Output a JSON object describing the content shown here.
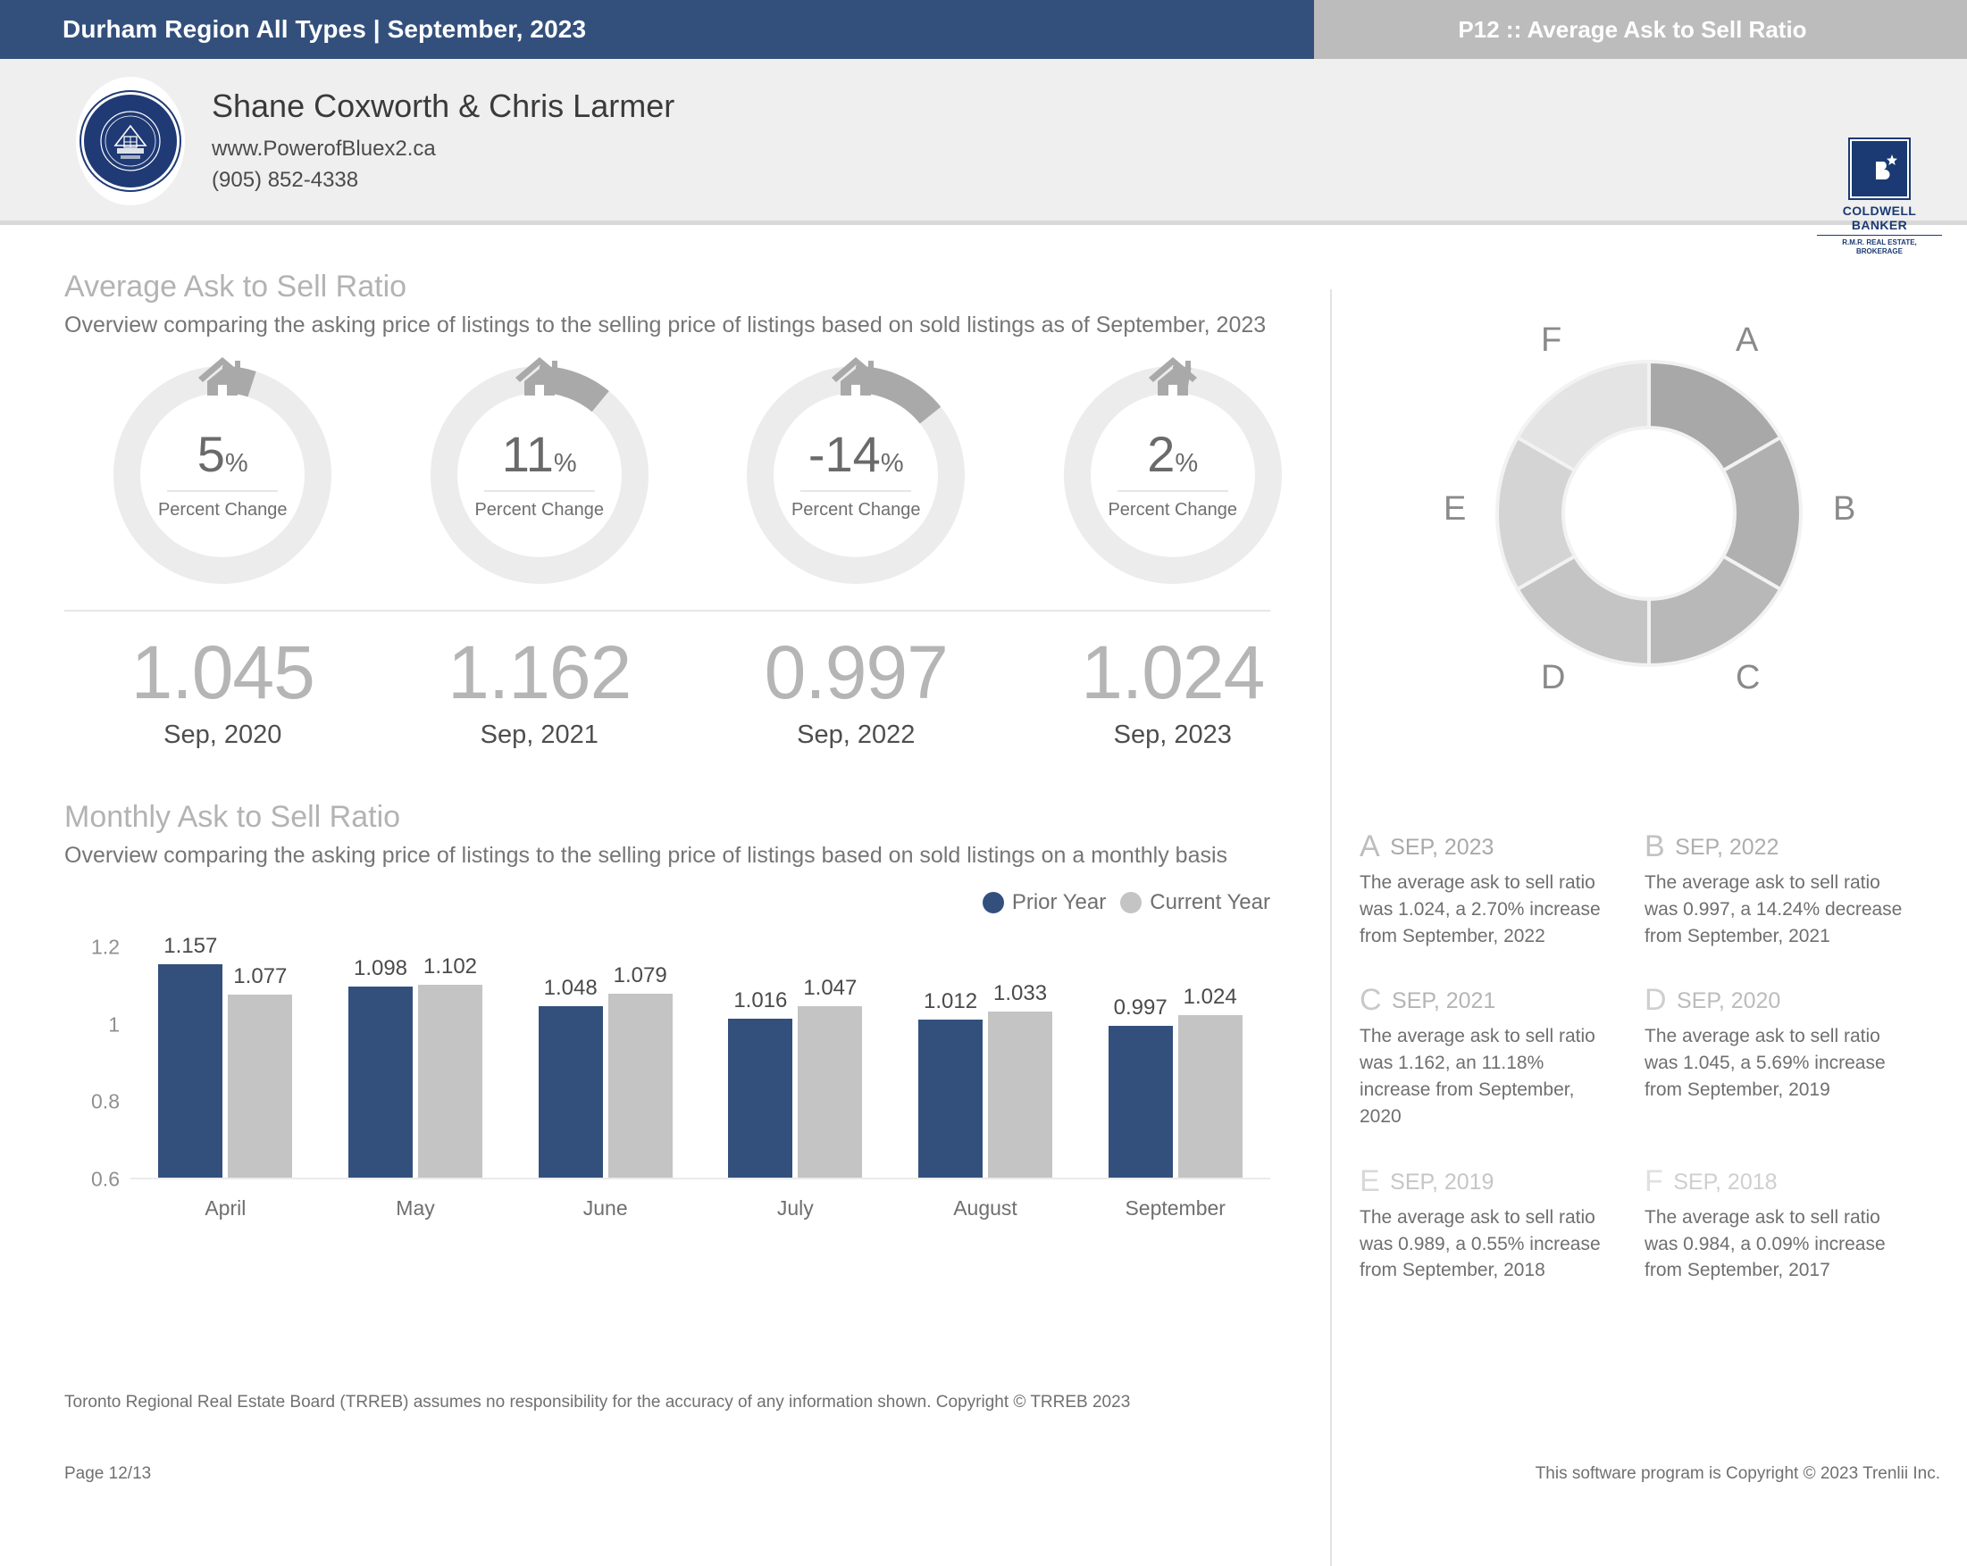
{
  "header": {
    "left_title": "Durham Region All Types | September, 2023",
    "right_title": "P12 :: Average Ask to Sell Ratio",
    "navy": "#33507d",
    "gray": "#bcbcbc"
  },
  "agent": {
    "name": "Shane Coxworth & Chris Larmer",
    "website": "www.PowerofBluex2.ca",
    "phone": "(905) 852-4338",
    "logo_icon": "powerofbluex2-seal-icon",
    "brokerage": {
      "mark": "CB",
      "name_line1": "COLDWELL",
      "name_line2": "BANKER",
      "sub_line1": "R.M.R. REAL ESTATE,",
      "sub_line2": "BROKERAGE"
    }
  },
  "overview": {
    "title": "Average Ask to Sell Ratio",
    "description": "Overview comparing the asking price of listings to the selling price of listings based on sold listings as of September, 2023",
    "gauges": [
      {
        "percent": "5",
        "symbol": "%",
        "label": "Percent Change",
        "fraction": 0.05,
        "icon": "house-icon"
      },
      {
        "percent": "11",
        "symbol": "%",
        "label": "Percent Change",
        "fraction": 0.11,
        "icon": "house-icon"
      },
      {
        "percent": "-14",
        "symbol": "%",
        "label": "Percent Change",
        "fraction": 0.1424,
        "icon": "house-icon"
      },
      {
        "percent": "2",
        "symbol": "%",
        "label": "Percent Change",
        "fraction": 0.027,
        "icon": "house-icon"
      }
    ],
    "totals": [
      {
        "value": "1.045",
        "label": "Sep, 2020"
      },
      {
        "value": "1.162",
        "label": "Sep, 2021"
      },
      {
        "value": "0.997",
        "label": "Sep, 2022"
      },
      {
        "value": "1.024",
        "label": "Sep, 2023"
      }
    ]
  },
  "monthly": {
    "title": "Monthly Ask to Sell Ratio",
    "description": "Overview comparing the asking price of listings to the selling price of listings based on sold listings on a monthly basis",
    "legend": [
      {
        "label": "Prior Year",
        "color": "#33507d"
      },
      {
        "label": "Current Year",
        "color": "#c4c4c4"
      }
    ]
  },
  "chart_data": {
    "type": "bar",
    "title": "Monthly Ask to Sell Ratio",
    "xlabel": "",
    "ylabel": "",
    "ylim": [
      0.6,
      1.2
    ],
    "yticks": [
      "0.6",
      "0.8",
      "1",
      "1.2"
    ],
    "grid": false,
    "legend_position": "top-right",
    "categories": [
      "April",
      "May",
      "June",
      "July",
      "August",
      "September"
    ],
    "series": [
      {
        "name": "Prior Year",
        "color": "#33507d",
        "values": [
          1.157,
          1.098,
          1.048,
          1.016,
          1.012,
          0.997
        ]
      },
      {
        "name": "Current Year",
        "color": "#c4c4c4",
        "values": [
          1.077,
          1.102,
          1.079,
          1.047,
          1.033,
          1.024
        ]
      }
    ],
    "value_labels": [
      [
        "1.157",
        "1.077"
      ],
      [
        "1.098",
        "1.102"
      ],
      [
        "1.048",
        "1.079"
      ],
      [
        "1.016",
        "1.047"
      ],
      [
        "1.012",
        "1.033"
      ],
      [
        "0.997",
        "1.024"
      ]
    ]
  },
  "donut": {
    "type": "donut",
    "segments": [
      {
        "letter": "A",
        "color": "#a8a8a8",
        "share": 16.667
      },
      {
        "letter": "B",
        "color": "#b0b0b0",
        "share": 16.667
      },
      {
        "letter": "C",
        "color": "#b8b8b8",
        "share": 16.667
      },
      {
        "letter": "D",
        "color": "#c4c4c4",
        "share": 16.667
      },
      {
        "letter": "E",
        "color": "#d4d4d4",
        "share": 16.667
      },
      {
        "letter": "F",
        "color": "#e4e4e4",
        "share": 16.667
      }
    ]
  },
  "cards": [
    {
      "letter": "A",
      "period": "SEP, 2023",
      "text": "The average ask to sell ratio was 1.024, a 2.70% increase from September, 2022",
      "letter_color": "#bdbdbd",
      "period_color": "#a9a9a9"
    },
    {
      "letter": "B",
      "period": "SEP, 2022",
      "text": "The average ask to sell ratio was 0.997, a 14.24% decrease from September, 2021",
      "letter_color": "#c2c2c2",
      "period_color": "#aeaeae"
    },
    {
      "letter": "C",
      "period": "SEP, 2021",
      "text": "The average ask to sell ratio was 1.162, an 11.18% increase from September, 2020",
      "letter_color": "#c9c9c9",
      "period_color": "#b5b5b5"
    },
    {
      "letter": "D",
      "period": "SEP, 2020",
      "text": "The average ask to sell ratio was 1.045, a 5.69% increase from September, 2019",
      "letter_color": "#cfcfcf",
      "period_color": "#bcbcbc"
    },
    {
      "letter": "E",
      "period": "SEP, 2019",
      "text": "The average ask to sell ratio was 0.989, a 0.55% increase from September, 2018",
      "letter_color": "#d8d8d8",
      "period_color": "#c6c6c6"
    },
    {
      "letter": "F",
      "period": "SEP, 2018",
      "text": "The average ask to sell ratio was 0.984, a 0.09% increase from September, 2017",
      "letter_color": "#e0e0e0",
      "period_color": "#cfcfcf"
    }
  ],
  "footer": {
    "disclaimer": "Toronto Regional Real Estate Board (TRREB) assumes no responsibility for the accuracy of any information shown. Copyright © TRREB 2023",
    "page": "Page 12/13",
    "software": "This software program is Copyright © 2023 Trenlii Inc."
  }
}
